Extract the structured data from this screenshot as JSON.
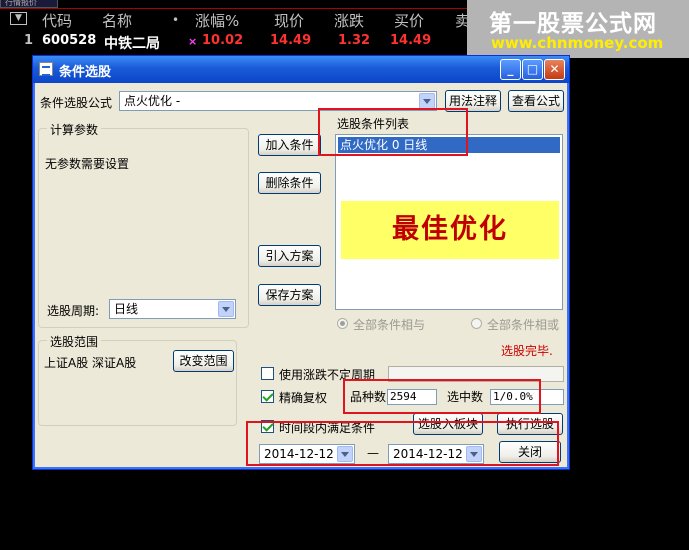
{
  "header": {
    "tab": "行情报价",
    "columns": [
      "代码",
      "名称",
      "•",
      "涨幅%",
      "现价",
      "涨跌",
      "买价",
      "卖"
    ]
  },
  "row": {
    "index": "1",
    "code": "600528",
    "name": "中铁二局",
    "marker": "×",
    "change_pct": "10.02",
    "price": "14.49",
    "change": "1.32",
    "bid": "14.49"
  },
  "watermark": {
    "title": "第一股票公式网",
    "url": "www.chnmoney.com"
  },
  "dialog": {
    "title": "条件选股",
    "formula_label": "条件选股公式",
    "formula_value": "点火优化  -",
    "usage_button": "用法注释",
    "view_button": "查看公式",
    "params_group": "计算参数",
    "no_params": "无参数需要设置",
    "period_label": "选股周期:",
    "period_value": "日线",
    "add_button": "加入条件",
    "delete_button": "删除条件",
    "import_button": "引入方案",
    "save_button": "保存方案",
    "list_title": "选股条件列表",
    "list_items": [
      "点火优化  0  日线"
    ],
    "banner": "最佳优化",
    "radio_and": "全部条件相与",
    "radio_or": "全部条件相或",
    "status": "选股完毕.",
    "range_group": "选股范围",
    "range_text": "上证A股  深证A股",
    "change_range_button": "改变范围",
    "chk_uncertain": "使用涨跌不定周期",
    "chk_exact": "精确复权",
    "chk_period": "时间段内满足条件",
    "count_label": "品种数",
    "count_value": "2594",
    "selected_label": "选中数",
    "selected_value": "1/0.0%",
    "to_block_button": "选股入板块",
    "execute_button": "执行选股",
    "date_start": "2014-12-12",
    "date_sep": "—",
    "date_end": "2014-12-12",
    "close_button": "关闭"
  },
  "colors": {
    "terminal_bg": "#000000",
    "label_gray": "#c0c0c0",
    "up_red": "#ff3232",
    "code_white": "#ffffff",
    "dialog_bg": "#ece9d8",
    "titlebar_blue": "#0b46c8",
    "banner_bg": "#ffff66",
    "banner_text": "#c00000",
    "highlight_red": "#e0141e"
  },
  "icons": [
    "dropdown-icon",
    "dialog-app-icon",
    "minimize-icon",
    "maximize-icon",
    "close-icon",
    "chevron-down-icon",
    "checkbox-icon",
    "radio-icon"
  ]
}
